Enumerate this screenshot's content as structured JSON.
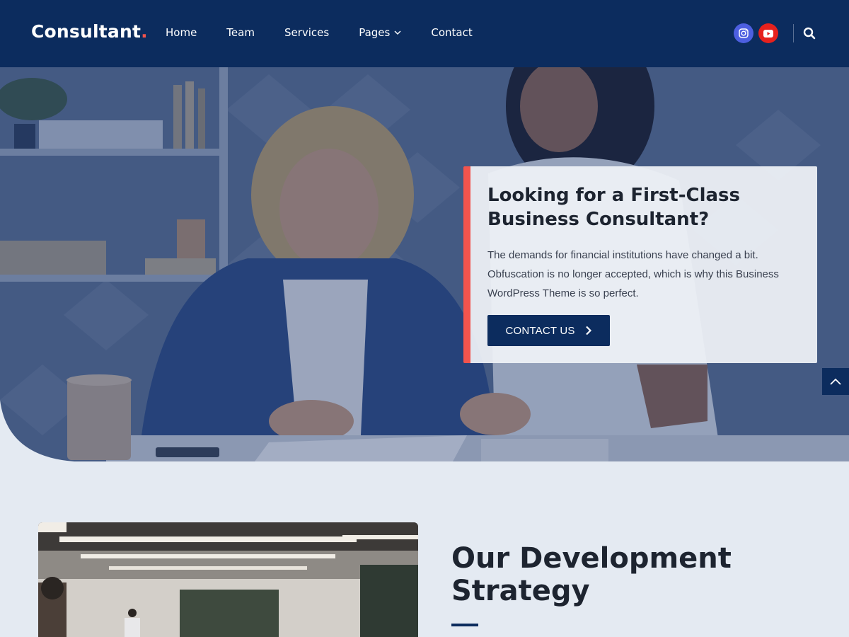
{
  "header": {
    "logo_text": "Consultant",
    "logo_dot": ".",
    "nav": [
      {
        "label": "Home"
      },
      {
        "label": "Team"
      },
      {
        "label": "Services"
      },
      {
        "label": "Pages",
        "has_dropdown": true
      },
      {
        "label": "Contact"
      }
    ],
    "social": [
      {
        "icon": "instagram-icon",
        "color": "#4d5fe0"
      },
      {
        "icon": "youtube-icon",
        "color": "#e6211d"
      }
    ],
    "search_icon": "search-icon"
  },
  "hero": {
    "title": "Looking for a First-Class Business Consultant?",
    "text": "The demands for financial institutions have changed a bit. Obfuscation is no longer accepted, which is why this Business WordPress Theme is so perfect.",
    "button_label": "CONTACT US",
    "button_icon": "chevron-right-icon"
  },
  "back_to_top_icon": "chevron-up-icon",
  "section": {
    "title": "Our Development Strategy"
  },
  "colors": {
    "primary": "#0c2c5e",
    "accent": "#f2544d",
    "background": "#e4eaf2",
    "text": "#1d2430"
  }
}
